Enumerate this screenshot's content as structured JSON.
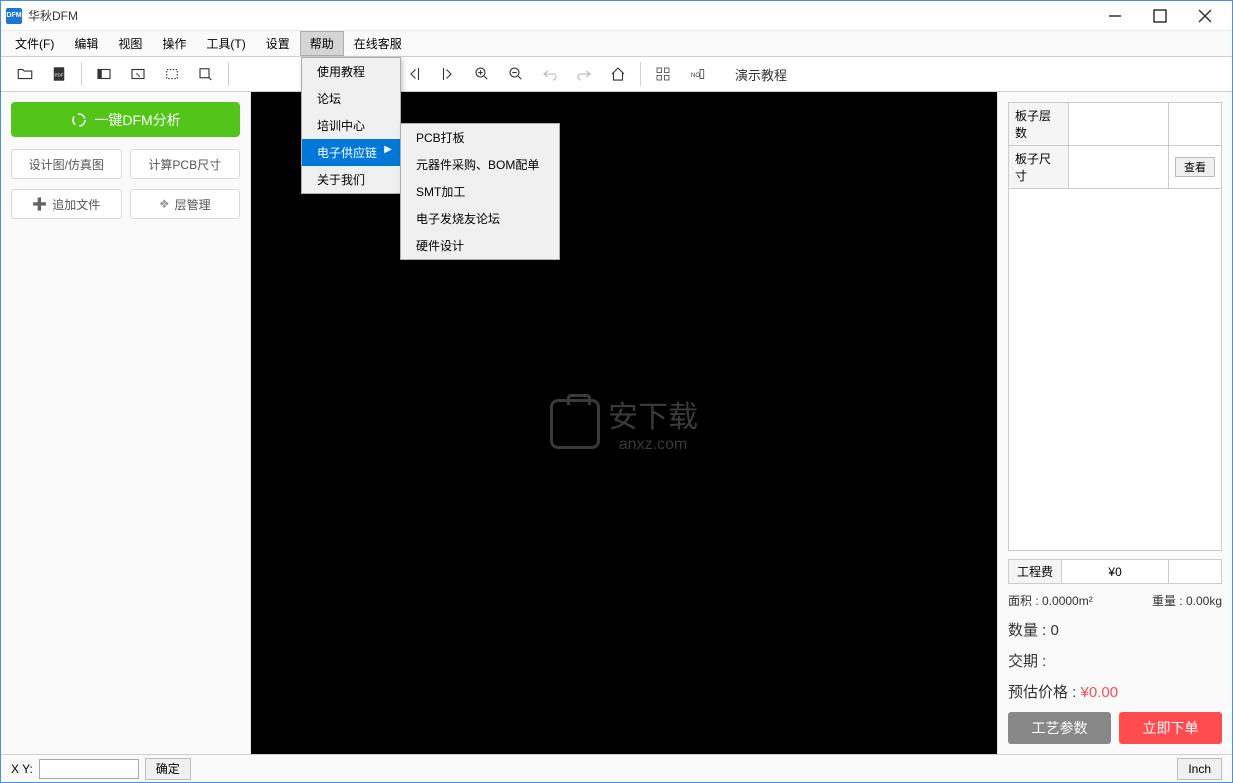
{
  "title": "华秋DFM",
  "app_icon_text": "DFM",
  "menubar": [
    "文件(F)",
    "编辑",
    "视图",
    "操作",
    "工具(T)",
    "设置",
    "帮助",
    "在线客服"
  ],
  "menubar_active_index": 6,
  "help_menu": {
    "items": [
      "使用教程",
      "论坛",
      "培训中心",
      "电子供应链",
      "关于我们"
    ],
    "highlighted_index": 3,
    "has_submenu_index": 3
  },
  "sub_menu": {
    "items": [
      "PCB打板",
      "元器件采购、BOM配单",
      "SMT加工",
      "电子发烧友论坛",
      "硬件设计"
    ]
  },
  "toolbar_demo": "演示教程",
  "left": {
    "dfm_btn": "一键DFM分析",
    "design_btn": "设计图/仿真图",
    "calc_btn": "计算PCB尺寸",
    "add_file_btn": "追加文件",
    "layer_mgr_btn": "层管理"
  },
  "watermark": {
    "cn": "安下载",
    "en": "anxz.com"
  },
  "right": {
    "layers_label": "板子层数",
    "layers_value": "",
    "size_label": "板子尺寸",
    "size_value": "",
    "view_btn": "查看",
    "eng_fee_label": "工程费",
    "eng_fee_value": "¥0",
    "board_fee_value": "",
    "area_label": "面积 :",
    "area_value": "0.0000m²",
    "weight_label": "重量 :",
    "weight_value": "0.00kg",
    "qty_label": "数量 :",
    "qty_value": "0",
    "delivery_label": "交期 :",
    "delivery_value": "",
    "est_price_label": "预估价格 :",
    "est_price_value": "¥0.00",
    "tech_btn": "工艺参数",
    "order_btn": "立即下单"
  },
  "status": {
    "xy_label": "X Y:",
    "xy_value": "",
    "confirm_btn": "确定",
    "inch_btn": "Inch"
  }
}
